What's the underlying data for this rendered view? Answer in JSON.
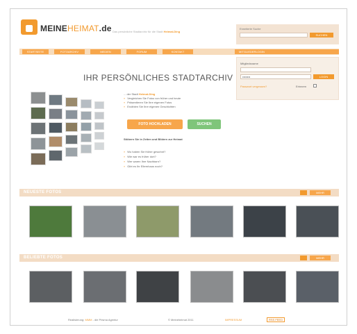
{
  "header": {
    "logo_text_main": "MEINE",
    "logo_text_accent": "HEIMAT",
    "logo_text_tld": ".de",
    "tagline_pre": "Das persönliche Stadtarchiv für die Stadt",
    "tagline_city": "Heimat-Ding"
  },
  "search": {
    "label": "Erweiterte Suche",
    "placeholder": "",
    "button": "SUCHEN"
  },
  "nav": {
    "items": [
      "STARTSEITE",
      "FOTOARCHIV",
      "MEDIEN",
      "FORUM",
      "KONTAKT"
    ],
    "member_tab": "MITGLIEDERLOGIN"
  },
  "login": {
    "username_label": "Mitgliedsname",
    "username_value": "",
    "password_value": "••••••••",
    "go_button": "LOGIN",
    "forgot": "Passwort vergessen?",
    "remember": "Erinnern"
  },
  "teaser": {
    "headline": "IHR PERSÖNLICHES STADTARCHIV",
    "city_line_pre": "... der Stadt",
    "city_line_city": "Heimat-Ding",
    "bullets": [
      "Vergleichen Sie Fotos von früher und heute",
      "Präsentieren Sie Ihre eigenen Fotos",
      "Erzählen Sie Ihre eigenen Geschichten"
    ],
    "upload_button": "FOTO HOCHLADEN",
    "search_button": "SUCHEN",
    "stoebern": "Stöbern Sie in Zeiten und Bildern zur Heimat",
    "questions": [
      "Wo haben Sie früher gewohnt?",
      "Wie war es früher dort?",
      "Wer waren Ihre Nachbarn?",
      "Gibt es Ihr Elternhaus noch?"
    ]
  },
  "sections": [
    {
      "title": "NEUESTE FOTOS",
      "badge": "",
      "badge2": "MEHR"
    },
    {
      "title": "BELIEBTE FOTOS",
      "badge": "",
      "badge2": "MEHR"
    }
  ],
  "footer": {
    "left_pre": "Realisierung:",
    "left_brand": "MMM",
    "left_post": "- die Prisma Agentur",
    "copyright": "© Meineheimat 2011",
    "impressum": "IMPRESSUM",
    "rss": "RSS FEED"
  },
  "colors": {
    "accent": "#f29a2e",
    "nav": "#f7a64b",
    "green": "#7fc57a"
  }
}
